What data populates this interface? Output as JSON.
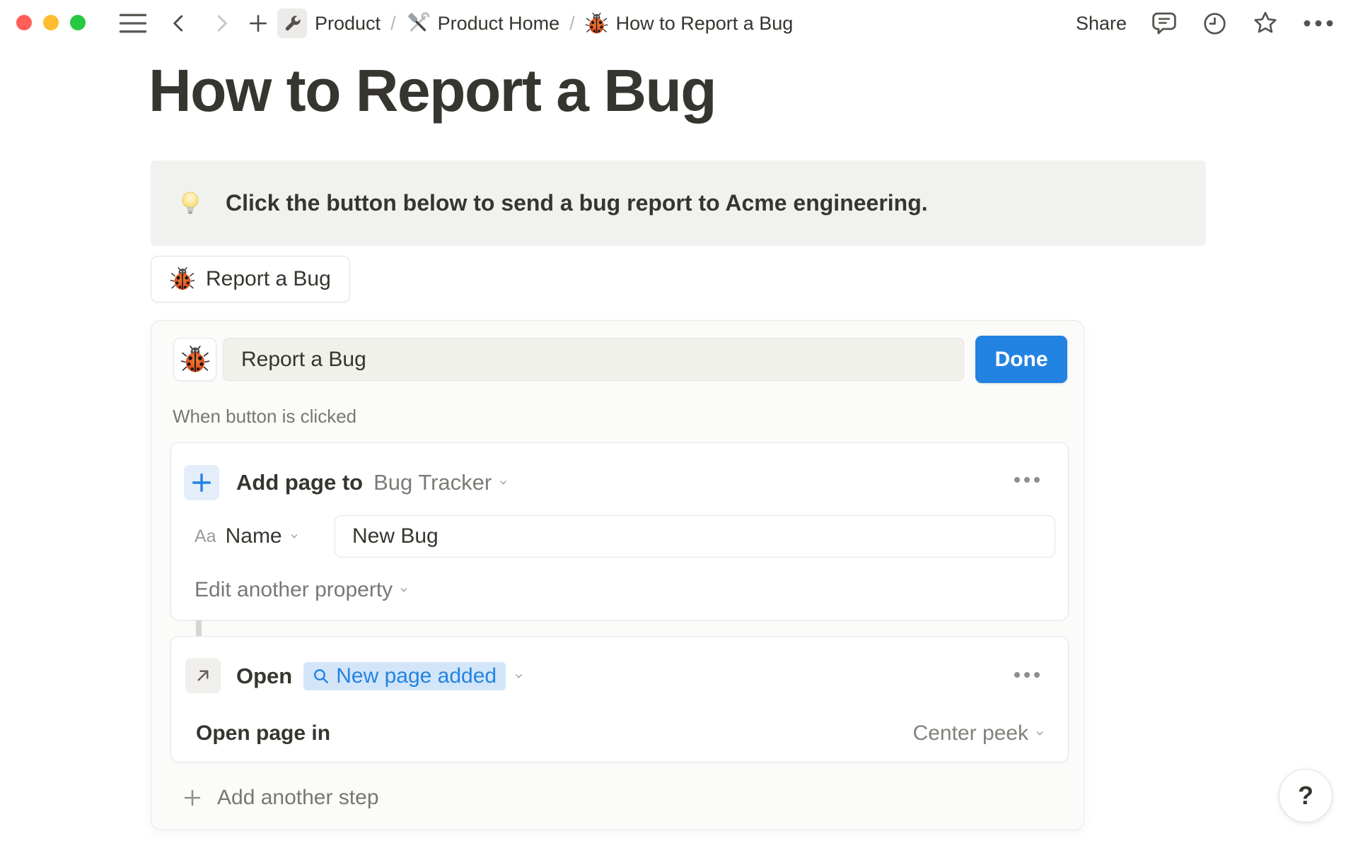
{
  "topbar": {
    "separator": "/",
    "breadcrumb": [
      {
        "icon": "wrench-icon",
        "label": "Product"
      },
      {
        "icon": "hammer-wrench-icon",
        "label": "Product Home"
      },
      {
        "icon": "ladybug-icon",
        "label": "How to Report a Bug"
      }
    ],
    "share_label": "Share"
  },
  "page": {
    "title": "How to Report a Bug"
  },
  "callout": {
    "icon": "lightbulb-icon",
    "text": "Click the button below to send a bug report to Acme engineering."
  },
  "bug_button": {
    "icon": "ladybug-icon",
    "label": "Report a Bug"
  },
  "editor": {
    "icon": "ladybug-icon",
    "button_name_value": "Report a Bug",
    "done_label": "Done",
    "trigger_label": "When button is clicked",
    "steps": [
      {
        "action_label": "Add page to",
        "target_label": "Bug Tracker",
        "property_type_icon": "Aa",
        "property_name": "Name",
        "property_value": "New Bug",
        "edit_another_label": "Edit another property"
      },
      {
        "action_label": "Open",
        "target_chip_label": "New page added",
        "setting_label": "Open page in",
        "setting_value": "Center peek"
      }
    ],
    "add_step_label": "Add another step"
  },
  "help_button": {
    "label": "?"
  },
  "colors": {
    "accent_blue": "#2383e2",
    "text_primary": "#37352f",
    "text_secondary": "#787774",
    "callout_bg": "#f1f1ef",
    "panel_bg": "#fbfbfa",
    "chip_bg": "#d3e5f8",
    "traffic_red": "#ff5f57",
    "traffic_yellow": "#febc2e",
    "traffic_green": "#28c840"
  }
}
